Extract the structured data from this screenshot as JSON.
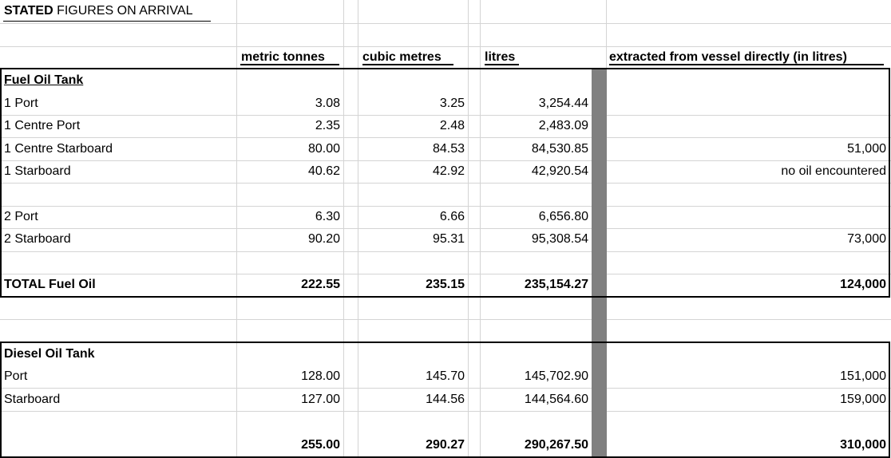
{
  "title": {
    "bold": "STATED",
    "rest": " FIGURES ON ARRIVAL"
  },
  "columns": {
    "metric_tonnes": "metric tonnes",
    "cubic_metres": "cubic metres",
    "litres": "litres",
    "extracted": "extracted from vessel directly (in litres)"
  },
  "fuel": {
    "heading": "Fuel Oil Tank",
    "rows": [
      {
        "name": "1 Port",
        "mt": "3.08",
        "cm": "3.25",
        "l": "3,254.44",
        "ex": ""
      },
      {
        "name": "1 Centre Port",
        "mt": "2.35",
        "cm": "2.48",
        "l": "2,483.09",
        "ex": ""
      },
      {
        "name": "1 Centre Starboard",
        "mt": "80.00",
        "cm": "84.53",
        "l": "84,530.85",
        "ex": "51,000"
      },
      {
        "name": "1 Starboard",
        "mt": "40.62",
        "cm": "42.92",
        "l": "42,920.54",
        "ex": "no oil encountered"
      },
      {
        "name": "2 Port",
        "mt": "6.30",
        "cm": "6.66",
        "l": "6,656.80",
        "ex": ""
      },
      {
        "name": "2 Starboard",
        "mt": "90.20",
        "cm": "95.31",
        "l": "95,308.54",
        "ex": "73,000"
      }
    ],
    "total": {
      "name": "TOTAL Fuel Oil",
      "mt": "222.55",
      "cm": "235.15",
      "l": "235,154.27",
      "ex": "124,000"
    }
  },
  "diesel": {
    "heading": "Diesel Oil Tank",
    "rows": [
      {
        "name": "Port",
        "mt": "128.00",
        "cm": "145.70",
        "l": "145,702.90",
        "ex": "151,000"
      },
      {
        "name": "Starboard",
        "mt": "127.00",
        "cm": "144.56",
        "l": "144,564.60",
        "ex": "159,000"
      }
    ],
    "total": {
      "name": "",
      "mt": "255.00",
      "cm": "290.27",
      "l": "290,267.50",
      "ex": "310,000"
    }
  }
}
